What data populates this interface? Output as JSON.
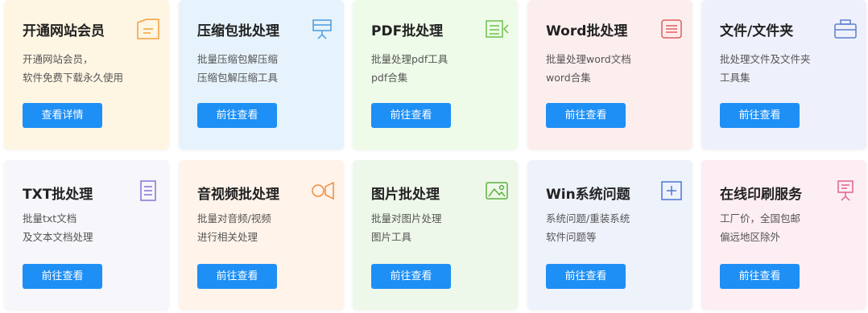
{
  "cards": [
    {
      "title": "开通网站会员",
      "desc1": "开通网站会员，",
      "desc2": "软件免费下载永久使用",
      "button": "查看详情",
      "bg": "#fff5e3",
      "icon": "membership-icon",
      "icon_color": "#f0a040"
    },
    {
      "title": "压缩包批处理",
      "desc1": "批量压缩包解压缩",
      "desc2": "压缩包解压缩工具",
      "button": "前往查看",
      "bg": "#e6f3fc",
      "icon": "compress-icon",
      "icon_color": "#4a9be0"
    },
    {
      "title": "PDF批处理",
      "desc1": "批量处理pdf工具",
      "desc2": "pdf合集",
      "button": "前往查看",
      "bg": "#eefbe8",
      "icon": "pdf-icon",
      "icon_color": "#6cc24a"
    },
    {
      "title": "Word批处理",
      "desc1": "批量处理word文档",
      "desc2": "word合集",
      "button": "前往查看",
      "bg": "#fdeeee",
      "icon": "word-icon",
      "icon_color": "#e25b5b"
    },
    {
      "title": "文件/文件夹",
      "desc1": "批处理文件及文件夹",
      "desc2": "工具集",
      "button": "前往查看",
      "bg": "#eef1fb",
      "icon": "folder-icon",
      "icon_color": "#5b7fd1"
    },
    {
      "title": "TXT批处理",
      "desc1": "批量txt文档",
      "desc2": "及文本文档处理",
      "button": "前往查看",
      "bg": "#f6f6fb",
      "icon": "txt-icon",
      "icon_color": "#8a70d6"
    },
    {
      "title": "音视频批处理",
      "desc1": "批量对音频/视频",
      "desc2": "进行相关处理",
      "button": "前往查看",
      "bg": "#fff3ea",
      "icon": "video-icon",
      "icon_color": "#f08c3a"
    },
    {
      "title": "图片批处理",
      "desc1": "批量对图片处理",
      "desc2": "图片工具",
      "button": "前往查看",
      "bg": "#eef8ea",
      "icon": "image-icon",
      "icon_color": "#5cb03e"
    },
    {
      "title": "Win系统问题",
      "desc1": "系统问题/重装系统",
      "desc2": "软件问题等",
      "button": "前往查看",
      "bg": "#eef2fb",
      "icon": "windows-icon",
      "icon_color": "#4a78d6"
    },
    {
      "title": "在线印刷服务",
      "desc1": "工厂价，全国包邮",
      "desc2": "偏远地区除外",
      "button": "前往查看",
      "bg": "#fdeef3",
      "icon": "print-icon",
      "icon_color": "#e0608c"
    }
  ],
  "button_color": "#1e8ff5"
}
